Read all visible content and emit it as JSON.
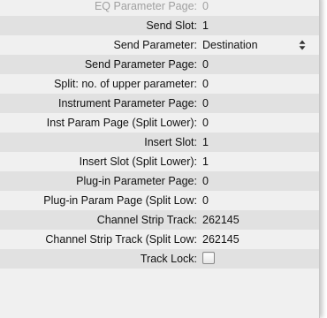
{
  "inspector": {
    "rows": [
      {
        "label": "EQ Parameter Page:",
        "value": "0"
      },
      {
        "label": "Send Slot:",
        "value": "1"
      },
      {
        "label": "Send Parameter:",
        "value": "Destination"
      },
      {
        "label": "Send Parameter Page:",
        "value": "0"
      },
      {
        "label": "Split: no. of upper parameter:",
        "value": "0"
      },
      {
        "label": "Instrument Parameter Page:",
        "value": "0"
      },
      {
        "label": "Inst Param Page (Split Lower):",
        "value": "0"
      },
      {
        "label": "Insert Slot:",
        "value": "1"
      },
      {
        "label": "Insert Slot (Split Lower):",
        "value": "1"
      },
      {
        "label": "Plug-in Parameter Page:",
        "value": "0"
      },
      {
        "label": "Plug-in Param Page (Split Low:",
        "value": "0"
      },
      {
        "label": "Channel Strip Track:",
        "value": "262145"
      },
      {
        "label": "Channel Strip Track (Split Low:",
        "value": "262145"
      },
      {
        "label": "Track Lock:",
        "value": ""
      }
    ],
    "track_lock_checked": false
  }
}
